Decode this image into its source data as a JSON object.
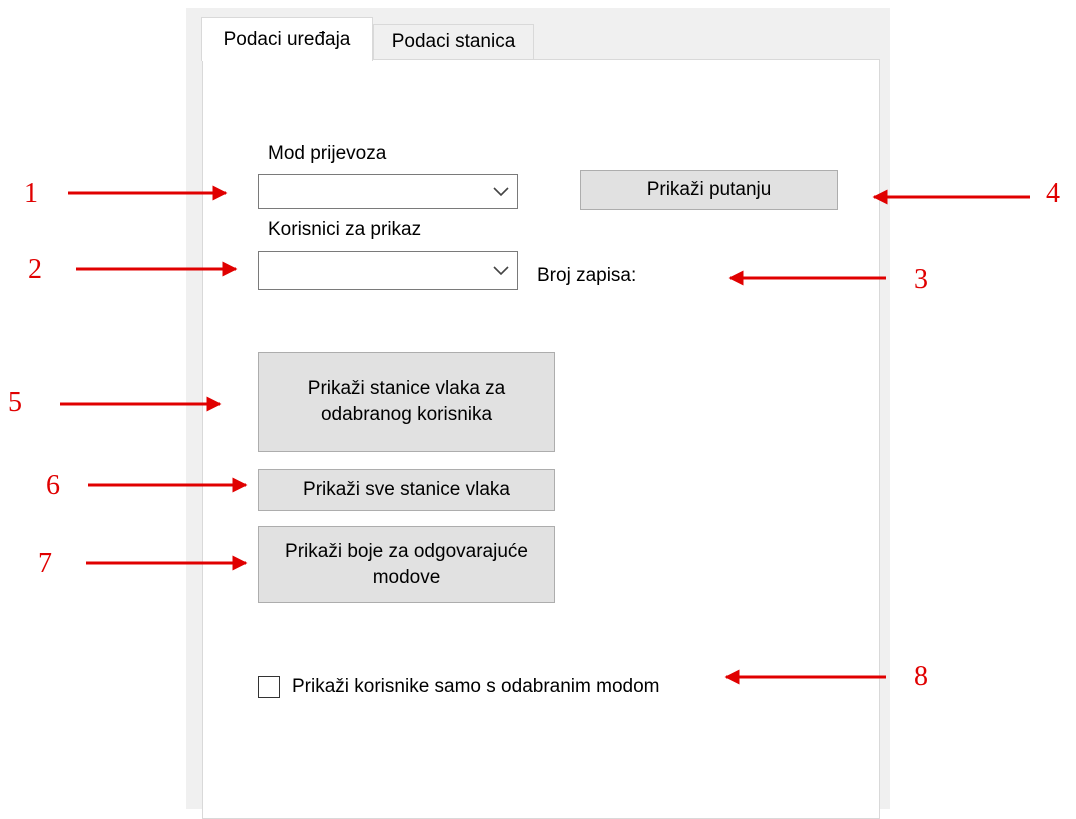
{
  "tabs": [
    "Podaci uređaja",
    "Podaci stanica"
  ],
  "labels": {
    "mode": "Mod prijevoza",
    "users": "Korisnici za prikaz",
    "record_count": "Broj zapisa:"
  },
  "combos": {
    "mode_value": "",
    "users_value": ""
  },
  "buttons": {
    "show_path": "Prikaži putanju",
    "show_user_stations": "Prikaži stanice vlaka za\nodabranog korisnika",
    "show_all_stations": "Prikaži sve stanice vlaka",
    "show_mode_colors": "Prikaži boje za odgovarajuće\nmodove"
  },
  "checkbox": {
    "label": "Prikaži korisnike samo s odabranim modom",
    "checked": false
  },
  "annotations": [
    "1",
    "2",
    "3",
    "4",
    "5",
    "6",
    "7",
    "8"
  ],
  "colors": {
    "annotation": "#e00000",
    "button": "#e1e1e1",
    "panel": "#f0f0f0"
  }
}
